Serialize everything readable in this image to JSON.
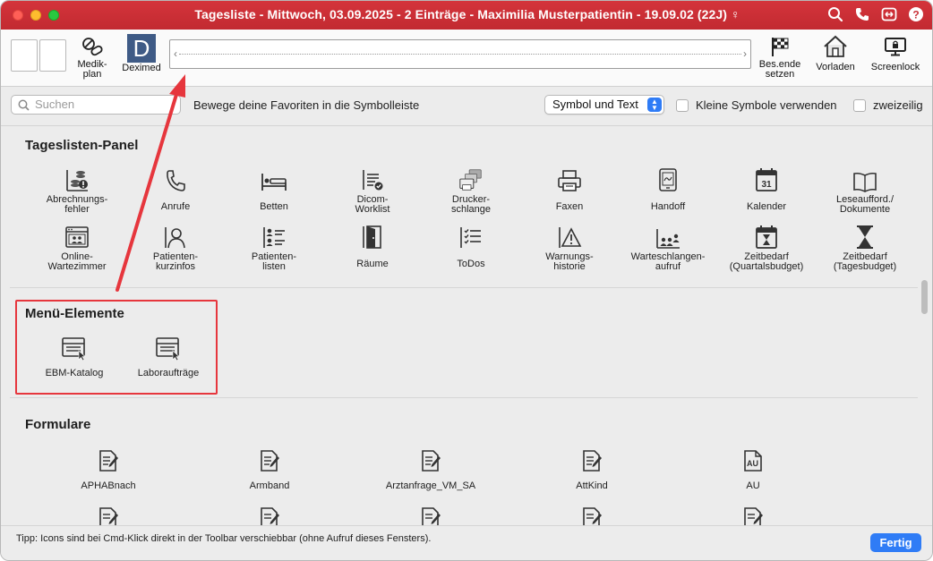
{
  "window": {
    "title": "Tagesliste - Mittwoch, 03.09.2025 - 2 Einträge - Maximilia Musterpatientin - 19.09.02 (22J) ♀",
    "title_icons": [
      "search-icon",
      "phone-icon",
      "transfer-icon",
      "help-icon"
    ],
    "help_label": "?"
  },
  "toolbar": {
    "medikplan_label_1": "Medik-",
    "medikplan_label_2": "plan",
    "deximed_label": "Deximed",
    "deximed_letter": "D",
    "slot_left": "‹",
    "slot_right": "›",
    "besende_label_1": "Bes.ende",
    "besende_label_2": "setzen",
    "vorladen_label": "Vorladen",
    "screenlock_label": "Screenlock"
  },
  "filter": {
    "search_placeholder": "Suchen",
    "hint": "Bewege deine Favoriten in die Symbolleiste",
    "display_mode": "Symbol und Text",
    "small_icons_label": "Kleine Symbole verwenden",
    "two_rows_label": "zweizeilig"
  },
  "sections": {
    "panel": {
      "title": "Tageslisten-Panel",
      "row1": [
        {
          "l1": "Abrechnungs-",
          "l2": "fehler",
          "icon": "billing-error-icon"
        },
        {
          "l1": "Anrufe",
          "l2": "",
          "icon": "phone-icon"
        },
        {
          "l1": "Betten",
          "l2": "",
          "icon": "bed-icon"
        },
        {
          "l1": "Dicom-",
          "l2": "Worklist",
          "icon": "worklist-icon"
        },
        {
          "l1": "Drucker-",
          "l2": "schlange",
          "icon": "printer-queue-icon"
        },
        {
          "l1": "Faxen",
          "l2": "",
          "icon": "fax-icon"
        },
        {
          "l1": "Handoff",
          "l2": "",
          "icon": "handoff-icon"
        },
        {
          "l1": "Kalender",
          "l2": "",
          "icon": "calendar-icon"
        },
        {
          "l1": "Leseaufford./",
          "l2": "Dokumente",
          "icon": "book-icon"
        }
      ],
      "row2": [
        {
          "l1": "Online-",
          "l2": "Wartezimmer",
          "icon": "online-waiting-room-icon"
        },
        {
          "l1": "Patienten-",
          "l2": "kurzinfos",
          "icon": "patient-info-icon"
        },
        {
          "l1": "Patienten-",
          "l2": "listen",
          "icon": "patient-list-icon"
        },
        {
          "l1": "Räume",
          "l2": "",
          "icon": "door-icon"
        },
        {
          "l1": "ToDos",
          "l2": "",
          "icon": "todo-icon"
        },
        {
          "l1": "Warnungs-",
          "l2": "historie",
          "icon": "warning-icon"
        },
        {
          "l1": "Warteschlangen-",
          "l2": "aufruf",
          "icon": "queue-call-icon"
        },
        {
          "l1": "Zeitbedarf",
          "l2": "(Quartalsbudget)",
          "icon": "calendar-hourglass-icon"
        },
        {
          "l1": "Zeitbedarf",
          "l2": "(Tagesbudget)",
          "icon": "hourglass-icon"
        }
      ],
      "calendar_day": "31"
    },
    "menu": {
      "title": "Menü-Elemente",
      "items": [
        {
          "label": "EBM-Katalog",
          "icon": "menu-element-icon"
        },
        {
          "label": "Laboraufträge",
          "icon": "menu-element-icon"
        }
      ]
    },
    "forms": {
      "title": "Formulare",
      "items": [
        {
          "label": "APHABnach",
          "icon": "form-icon"
        },
        {
          "label": "Armband",
          "icon": "form-icon"
        },
        {
          "label": "Arztanfrage_VM_SA",
          "icon": "form-icon"
        },
        {
          "label": "AttKind",
          "icon": "form-icon"
        },
        {
          "label": "AU",
          "icon": "au-form-icon"
        }
      ],
      "au_badge": "AU"
    }
  },
  "status": {
    "tip": "Tipp: Icons sind bei Cmd-Klick direkt in der Toolbar verschiebbar (ohne Aufruf dieses Fensters).",
    "done_label": "Fertig"
  },
  "colors": {
    "titlebar": "#c82f36",
    "accent_blue": "#2f7cf6",
    "highlight_red": "#e6363d"
  }
}
